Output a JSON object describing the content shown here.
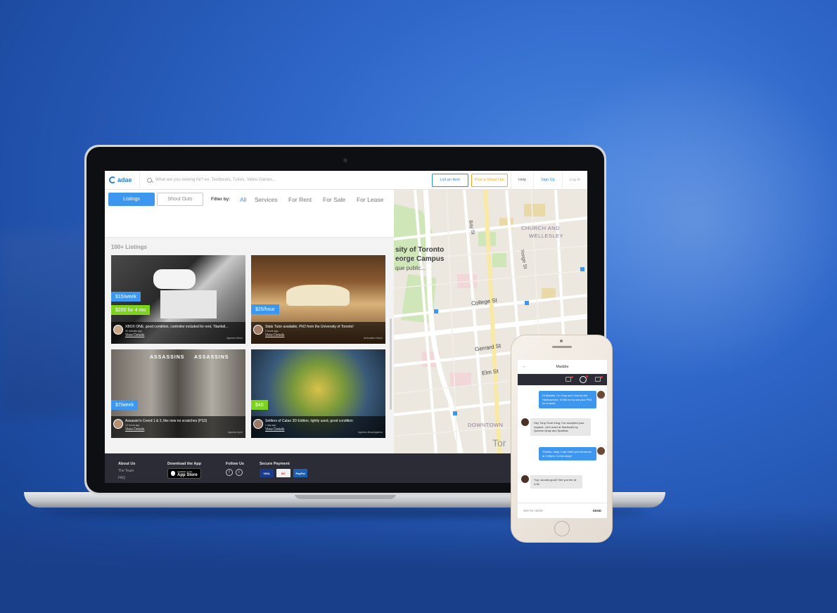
{
  "header": {
    "logo": "adae",
    "search_placeholder": "What are you looking for? ex. Textbooks, Tutors, Video Games...",
    "list_item_button": "List an Item",
    "shout_out_button": "Post a Shout Out",
    "help_link": "Help",
    "signup_link": "Sign Up",
    "login_link": "Log In"
  },
  "filters": {
    "tabs": [
      "Listings",
      "Shout Outs"
    ],
    "filter_label": "Filter by:",
    "options": [
      "All",
      "Services",
      "For Rent",
      "For Sale",
      "For Lease"
    ],
    "selected": "All"
  },
  "listings": {
    "count_label": "100+ Listings",
    "items": [
      {
        "price": "$15/week",
        "price2": "$200 for 4 mo",
        "title": "XBOX ONE, good condition, controller included for rent, Titanfall...",
        "time": "30 minutes ago",
        "link": "View Details",
        "tag": "#games #xbox"
      },
      {
        "price": "$25/hour",
        "title": "Stats Tutor available, PhD from the University of Toronto!",
        "time": "3 hours ago",
        "link": "View Details",
        "tag": "#education #tutor"
      },
      {
        "price": "$7/week",
        "title": "Assassin's Creed 1 & 3, like new  no scratches (PS3)",
        "time": "12 hours ago",
        "link": "View Details",
        "tag": "#games #ps3"
      },
      {
        "price": "$40",
        "title": "Settlers of Catan 3D Edition, lightly used, good condition",
        "time": "1 day ago",
        "link": "View Details",
        "tag": "#games #boardgames"
      }
    ]
  },
  "map": {
    "labels": [
      "sity of Toronto",
      "eorge Campus",
      "que public...",
      "Bay St",
      "Yonge St",
      "CHURCH AND",
      "WELLESLEY",
      "College St",
      "Gerrard St",
      "Elm St",
      "DOWNTOWN",
      "Tor"
    ]
  },
  "footer": {
    "about_heading": "About Us",
    "about_links": [
      "The Team",
      "FAQ"
    ],
    "download_heading": "Download the App",
    "app_store_small": "Available on the",
    "app_store_big": "App Store",
    "follow_heading": "Follow Us",
    "payment_heading": "Secure Payment",
    "payment_cards": [
      "VISA",
      "MC",
      "PayPal"
    ]
  },
  "phone": {
    "chat_name": "Maddie",
    "messages": [
      {
        "from": "me",
        "text": "Hi Maddie, I'm Tony and I live by the Harbourfront. I'd like to try out your PS4 for a week."
      },
      {
        "from": "them",
        "text": "Hey Tony! Sure thing, I've accepted your request. Let's meet at Starbucks by Queens Quay and Spadina."
      },
      {
        "from": "me",
        "text": "Thanks, okay, I can meet you tomorrow at 4:30pm. Is that okay?"
      },
      {
        "from": "them",
        "text": "Yup, sounds good! See you tmr at 4:30."
      }
    ],
    "input_placeholder": "WRITE HERE",
    "send_label": "SEND"
  },
  "colors": {
    "accent": "#3e97ef",
    "shout": "#f5a623",
    "green": "#7ed321",
    "footer": "#2b2c36"
  }
}
